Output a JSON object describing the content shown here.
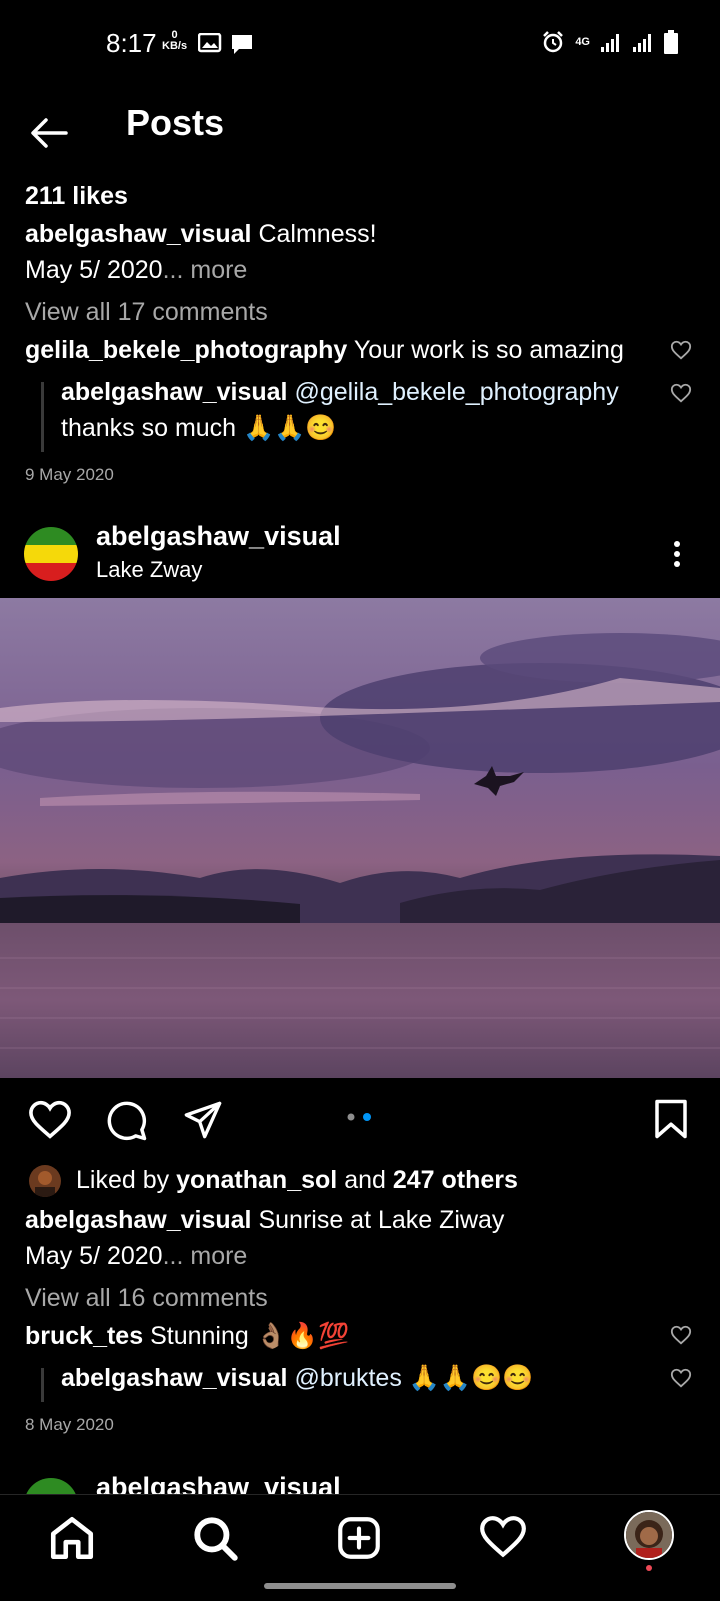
{
  "status_bar": {
    "time": "8:17",
    "net_speed_value": "0",
    "net_speed_unit": "KB/s",
    "network_label": "4G"
  },
  "header": {
    "title": "Posts"
  },
  "post1": {
    "likes": "211 likes",
    "username": "abelgashaw_visual",
    "caption": "Calmness!",
    "caption_line2": "May 5/ 2020",
    "more": "... more",
    "view_comments": "View all 17 comments",
    "comment": {
      "user": "gelila_bekele_photography",
      "text": "Your work is so amazing"
    },
    "reply": {
      "user": "abelgashaw_visual",
      "mention": "@gelila_bekele_photography",
      "text": "thanks so much 🙏🙏😊"
    },
    "date": "9 May 2020"
  },
  "post2": {
    "username": "abelgashaw_visual",
    "location": "Lake Zway",
    "liked_by_prefix": "Liked by",
    "liked_by_user": "yonathan_sol",
    "liked_by_and": "and",
    "liked_by_others": "247 others",
    "caption_user": "abelgashaw_visual",
    "caption": "Sunrise at Lake Ziway",
    "caption_line2": "May 5/ 2020",
    "more": "... more",
    "view_comments": "View all 16 comments",
    "comment": {
      "user": "bruck_tes",
      "text": "Stunning 👌🏽🔥💯"
    },
    "reply": {
      "user": "abelgashaw_visual",
      "mention": "@bruktes",
      "text": "🙏🙏😊😊"
    },
    "date": "8 May 2020",
    "carousel": {
      "count": 2,
      "active": 2
    }
  },
  "post3": {
    "username": "abelgashaw_visual"
  },
  "nav": {
    "items": [
      "home-icon",
      "search-icon",
      "add-post-icon",
      "activity-heart-icon",
      "profile-avatar"
    ]
  },
  "colors": {
    "background": "#000000",
    "accent": "#0095f6",
    "notification": "#ed4956"
  }
}
